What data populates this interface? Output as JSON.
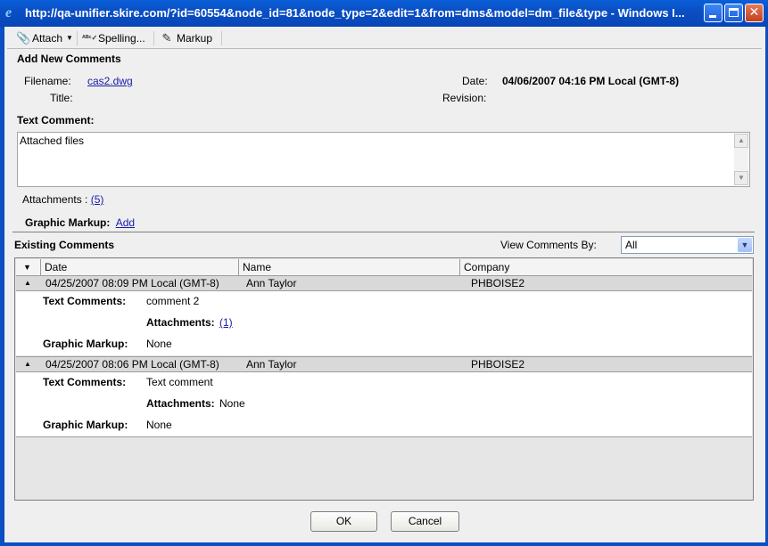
{
  "window": {
    "title": "http://qa-unifier.skire.com/?id=60554&node_id=81&node_type=2&edit=1&from=dms&model=dm_file&type - Windows I...",
    "icon": "ie-icon"
  },
  "toolbar": {
    "attach_label": "Attach",
    "spelling_label": "Spelling...",
    "markup_label": "Markup"
  },
  "form": {
    "heading": "Add New Comments",
    "filename_label": "Filename:",
    "filename_value": "cas2.dwg",
    "title_label": "Title:",
    "date_label": "Date:",
    "date_value": "04/06/2007 04:16 PM Local (GMT-8)",
    "revision_label": "Revision:",
    "text_comment_label": "Text Comment:",
    "text_comment_value": "Attached files",
    "attachments_label": "Attachments : ",
    "attachments_value": "(5)",
    "graphic_markup_label": "Graphic Markup:",
    "graphic_markup_add": "Add"
  },
  "existing": {
    "heading": "Existing Comments",
    "view_by_label": "View Comments By:",
    "view_by_value": "All",
    "columns": [
      "Date",
      "Name",
      "Company"
    ],
    "comments": [
      {
        "date": "04/25/2007 08:09 PM Local (GMT-8)",
        "name": "Ann  Taylor",
        "company": "PHBOISE2",
        "text_label": "Text Comments:",
        "text": "comment 2",
        "attachments_label": "Attachments:",
        "attachments": "(1)",
        "markup_label": "Graphic Markup:",
        "markup": "None"
      },
      {
        "date": "04/25/2007 08:06 PM Local (GMT-8)",
        "name": "Ann  Taylor",
        "company": "PHBOISE2",
        "text_label": "Text Comments:",
        "text": "Text comment",
        "attachments_label": "Attachments:",
        "attachments": "None",
        "markup_label": "Graphic Markup:",
        "markup": "None"
      }
    ]
  },
  "buttons": {
    "ok": "OK",
    "cancel": "Cancel"
  }
}
